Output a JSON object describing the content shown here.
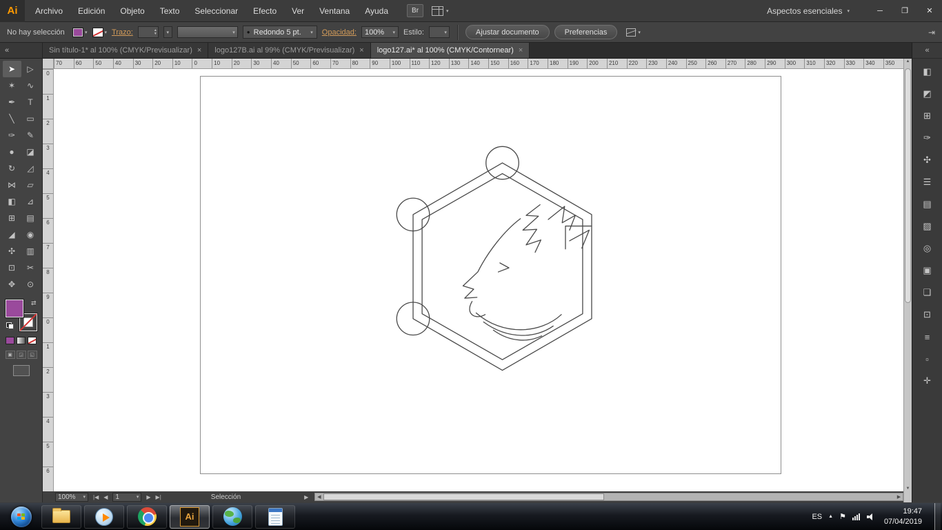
{
  "menubar": {
    "logo": "Ai",
    "items": [
      "Archivo",
      "Edición",
      "Objeto",
      "Texto",
      "Seleccionar",
      "Efecto",
      "Ver",
      "Ventana",
      "Ayuda"
    ],
    "bridge_button": "Br",
    "workspace_label": "Aspectos esenciales"
  },
  "control_bar": {
    "selection_status": "No hay selección",
    "stroke_label": "Trazo:",
    "brush_value": "Redondo 5 pt.",
    "opacity_label": "Opacidad:",
    "opacity_value": "100%",
    "style_label": "Estilo:",
    "fit_document_button": "Ajustar documento",
    "preferences_button": "Preferencias"
  },
  "tabs": [
    {
      "label": "Sin título-1* al 100% (CMYK/Previsualizar)",
      "close": "×",
      "active": false
    },
    {
      "label": "logo127B.ai al 99% (CMYK/Previsualizar)",
      "close": "×",
      "active": false
    },
    {
      "label": "logo127.ai* al 100% (CMYK/Contornear)",
      "close": "×",
      "active": true
    }
  ],
  "rulers": {
    "horizontal": [
      "70",
      "60",
      "50",
      "40",
      "30",
      "20",
      "10",
      "0",
      "10",
      "20",
      "30",
      "40",
      "50",
      "60",
      "70",
      "80",
      "90",
      "100",
      "110",
      "120",
      "130",
      "140",
      "150",
      "160",
      "170",
      "180",
      "190",
      "200",
      "210",
      "220",
      "230",
      "240",
      "250",
      "260",
      "270",
      "280",
      "290",
      "300",
      "310",
      "320",
      "330",
      "340",
      "350"
    ],
    "vertical": [
      "0",
      "1",
      "2",
      "3",
      "4",
      "5",
      "6",
      "7",
      "8",
      "9",
      "0",
      "1",
      "2",
      "3",
      "4",
      "5",
      "6"
    ]
  },
  "tools": [
    {
      "name": "selection-tool",
      "glyph": "➤"
    },
    {
      "name": "direct-selection-tool",
      "glyph": "▷"
    },
    {
      "name": "magic-wand-tool",
      "glyph": "✶"
    },
    {
      "name": "lasso-tool",
      "glyph": "∿"
    },
    {
      "name": "pen-tool",
      "glyph": "✒"
    },
    {
      "name": "type-tool",
      "glyph": "T"
    },
    {
      "name": "line-segment-tool",
      "glyph": "╲"
    },
    {
      "name": "rectangle-tool",
      "glyph": "▭"
    },
    {
      "name": "paintbrush-tool",
      "glyph": "✑"
    },
    {
      "name": "pencil-tool",
      "glyph": "✎"
    },
    {
      "name": "blob-brush-tool",
      "glyph": "●"
    },
    {
      "name": "eraser-tool",
      "glyph": "◪"
    },
    {
      "name": "rotate-tool",
      "glyph": "↻"
    },
    {
      "name": "scale-tool",
      "glyph": "◿"
    },
    {
      "name": "width-tool",
      "glyph": "⋈"
    },
    {
      "name": "free-transform-tool",
      "glyph": "▱"
    },
    {
      "name": "shape-builder-tool",
      "glyph": "◧"
    },
    {
      "name": "perspective-grid-tool",
      "glyph": "⊿"
    },
    {
      "name": "mesh-tool",
      "glyph": "⊞"
    },
    {
      "name": "gradient-tool",
      "glyph": "▤"
    },
    {
      "name": "eyedropper-tool",
      "glyph": "◢"
    },
    {
      "name": "blend-tool",
      "glyph": "◉"
    },
    {
      "name": "symbol-sprayer-tool",
      "glyph": "✣"
    },
    {
      "name": "column-graph-tool",
      "glyph": "▥"
    },
    {
      "name": "artboard-tool",
      "glyph": "⊡"
    },
    {
      "name": "slice-tool",
      "glyph": "✂"
    },
    {
      "name": "hand-tool",
      "glyph": "✥"
    },
    {
      "name": "zoom-tool",
      "glyph": "⊙"
    }
  ],
  "right_panels": [
    {
      "name": "color-panel",
      "glyph": "◧"
    },
    {
      "name": "color-guide-panel",
      "glyph": "◩"
    },
    {
      "name": "swatches-panel",
      "glyph": "⊞"
    },
    {
      "name": "brushes-panel",
      "glyph": "✑"
    },
    {
      "name": "symbols-panel",
      "glyph": "✣"
    },
    {
      "name": "stroke-panel",
      "glyph": "☰"
    },
    {
      "name": "gradient-panel",
      "glyph": "▤"
    },
    {
      "name": "transparency-panel",
      "glyph": "▨"
    },
    {
      "name": "appearance-panel",
      "glyph": "◎"
    },
    {
      "name": "graphic-styles-panel",
      "glyph": "▣"
    },
    {
      "name": "layers-panel",
      "glyph": "❏"
    },
    {
      "name": "artboards-panel",
      "glyph": "⊡"
    },
    {
      "name": "align-panel",
      "glyph": "≡"
    },
    {
      "name": "pathfinder-panel",
      "glyph": "▫"
    },
    {
      "name": "transform-panel",
      "glyph": "✛"
    }
  ],
  "status_bar": {
    "zoom": "100%",
    "artboard_value": "1",
    "status_text": "Selección"
  },
  "taskbar": {
    "items": [
      {
        "name": "start"
      },
      {
        "name": "explorer"
      },
      {
        "name": "media-player"
      },
      {
        "name": "chrome"
      },
      {
        "name": "illustrator",
        "label": "Ai",
        "active": true
      },
      {
        "name": "gis-globe"
      },
      {
        "name": "notepad"
      }
    ],
    "tray": {
      "lang": "ES",
      "time": "19:47",
      "date": "07/04/2019"
    }
  },
  "icons": {
    "minimize": "─",
    "restore": "❐",
    "close": "✕",
    "panel_collapse": "«",
    "caret": "▾",
    "nav_first": "|◀",
    "nav_prev": "◀",
    "nav_next": "▶",
    "nav_last": "▶|",
    "flyout": "▶",
    "scroll_left": "◀",
    "scroll_right": "▶",
    "scroll_up": "▲",
    "scroll_down": "▼",
    "brush_dot": "●",
    "tray_arrow": "▲",
    "tray_flag": "⚑"
  },
  "colors": {
    "app_accent_orange": "#ff9a00",
    "fill_purple": "#9a4a9c",
    "link_label_orange": "#d49c5a",
    "artboard_background": "#ffffff",
    "outline_stroke": "#4a4a4a"
  }
}
